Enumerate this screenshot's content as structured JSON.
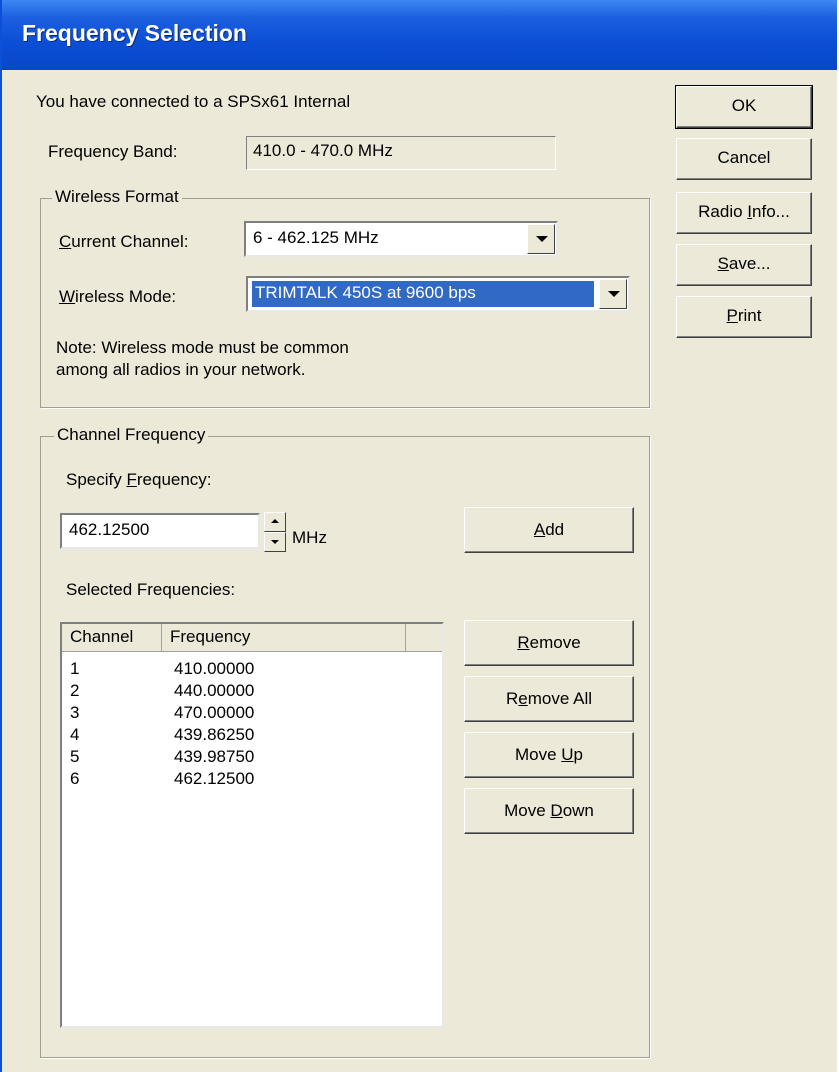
{
  "window": {
    "title": "Frequency Selection"
  },
  "info": {
    "connected_text": "You have connected to a SPSx61 Internal",
    "band_label": "Frequency Band:",
    "band_value": "410.0 - 470.0 MHz"
  },
  "wireless": {
    "legend": "Wireless Format",
    "channel_label": {
      "pre": "",
      "ul": "C",
      "post": "urrent Channel:"
    },
    "channel_value": "6 - 462.125 MHz",
    "mode_label": {
      "pre": "",
      "ul": "W",
      "post": "ireless Mode:"
    },
    "mode_value": "TRIMTALK 450S at 9600 bps",
    "note_line1": "Note: Wireless mode must be common",
    "note_line2": "among all radios in your network."
  },
  "channel_freq": {
    "legend": "Channel Frequency",
    "specify_label": {
      "pre": "Specify ",
      "ul": "F",
      "post": "requency:"
    },
    "freq_value": "462.12500",
    "unit": "MHz",
    "add_button": {
      "pre": "",
      "ul": "A",
      "post": "dd"
    },
    "selected_label": "Selected Frequencies:",
    "columns": [
      "Channel",
      "Frequency"
    ],
    "rows": [
      {
        "channel": "1",
        "frequency": "410.00000"
      },
      {
        "channel": "2",
        "frequency": "440.00000"
      },
      {
        "channel": "3",
        "frequency": "470.00000"
      },
      {
        "channel": "4",
        "frequency": "439.86250"
      },
      {
        "channel": "5",
        "frequency": "439.98750"
      },
      {
        "channel": "6",
        "frequency": "462.12500"
      }
    ],
    "remove_button": {
      "pre": "",
      "ul": "R",
      "post": "emove"
    },
    "remove_all_button": {
      "pre": "R",
      "ul": "e",
      "post": "move All"
    },
    "move_up_button": {
      "pre": "Move ",
      "ul": "U",
      "post": "p"
    },
    "move_down_button": {
      "pre": "Move ",
      "ul": "D",
      "post": "own"
    }
  },
  "side_buttons": {
    "ok": "OK",
    "cancel": "Cancel",
    "radio_info": {
      "pre": "Radio ",
      "ul": "I",
      "post": "nfo..."
    },
    "save": {
      "pre": "",
      "ul": "S",
      "post": "ave..."
    },
    "print": {
      "pre": "",
      "ul": "P",
      "post": "rint"
    }
  }
}
